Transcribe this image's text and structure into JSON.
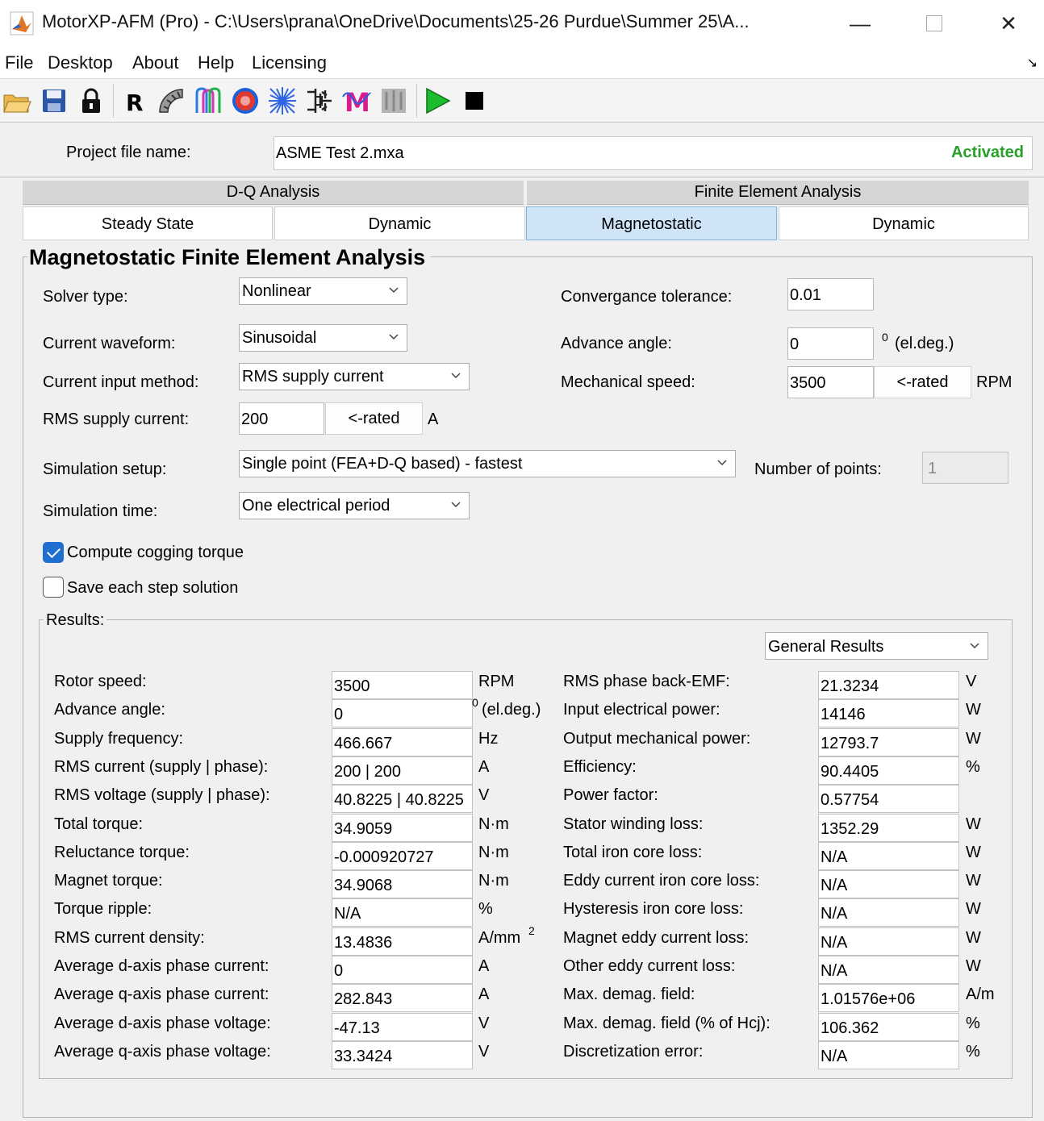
{
  "window": {
    "title": "MotorXP-AFM (Pro) - C:\\Users\\prana\\OneDrive\\Documents\\25-26 Purdue\\Summer 25\\A...",
    "minimize_glyph": "—",
    "close_glyph": "✕"
  },
  "menu": [
    "File",
    "Desktop",
    "About",
    "Help",
    "Licensing"
  ],
  "toolbar": {
    "icons": [
      "open-folder-icon",
      "save-icon",
      "lock-icon",
      "rating-r-icon",
      "stator-icon",
      "winding-icon",
      "magnet-circle-icon",
      "mesh-icon",
      "circuit-icon",
      "waveform-m-icon",
      "thermal-icon",
      "run-icon",
      "stop-icon"
    ],
    "rating_label": "R",
    "waveform_label": "M"
  },
  "project": {
    "label": "Project file name:",
    "file_name": "ASME Test 2.mxa",
    "status": "Activated",
    "status_color": "#2aa02a"
  },
  "group_tabs": [
    "D-Q Analysis",
    "Finite Element Analysis"
  ],
  "sub_tabs": [
    {
      "label": "Steady State",
      "active": false
    },
    {
      "label": "Dynamic",
      "active": false
    },
    {
      "label": "Magnetostatic",
      "active": true
    },
    {
      "label": "Dynamic",
      "active": false
    }
  ],
  "panel": {
    "title": "Magnetostatic Finite Element Analysis",
    "solver_type": {
      "label": "Solver type:",
      "value": "Nonlinear"
    },
    "current_waveform": {
      "label": "Current waveform:",
      "value": "Sinusoidal"
    },
    "current_input_method": {
      "label": "Current input method:",
      "value": "RMS supply current"
    },
    "rms_supply_current": {
      "label": "RMS supply current:",
      "value": "200",
      "button": "<-rated",
      "unit": "A"
    },
    "convergence_tolerance": {
      "label": "Convergance tolerance:",
      "value": "0.01"
    },
    "advance_angle": {
      "label": "Advance angle:",
      "value": "0",
      "unit_sup": "0",
      "unit": "(el.deg.)"
    },
    "mechanical_speed": {
      "label": "Mechanical speed:",
      "value": "3500",
      "button": "<-rated",
      "unit": "RPM"
    },
    "simulation_setup": {
      "label": "Simulation setup:",
      "value": "Single point (FEA+D-Q based) - fastest"
    },
    "number_of_points": {
      "label": "Number of points:",
      "value": "1"
    },
    "simulation_time": {
      "label": "Simulation time:",
      "value": "One electrical period"
    },
    "compute_cogging": {
      "label": "Compute cogging torque",
      "checked": true
    },
    "save_each_step": {
      "label": "Save each step solution",
      "checked": false
    }
  },
  "results": {
    "title": "Results:",
    "view": "General Results",
    "left": [
      {
        "label": "Rotor speed:",
        "value": "3500",
        "unit": "RPM"
      },
      {
        "label": "Advance angle:",
        "value": "0",
        "unit": "(el.deg.)",
        "unit_sup": "0"
      },
      {
        "label": "Supply frequency:",
        "value": "466.667",
        "unit": "Hz"
      },
      {
        "label": "RMS current (supply | phase):",
        "value": "200 | 200",
        "unit": "A"
      },
      {
        "label": "RMS voltage (supply | phase):",
        "value": "40.8225 | 40.8225",
        "unit": "V"
      },
      {
        "label": "Total torque:",
        "value": "34.9059",
        "unit": "N·m"
      },
      {
        "label": "Reluctance torque:",
        "value": "-0.000920727",
        "unit": "N·m"
      },
      {
        "label": "Magnet torque:",
        "value": "34.9068",
        "unit": "N·m"
      },
      {
        "label": "Torque ripple:",
        "value": "N/A",
        "unit": "%"
      },
      {
        "label": "RMS current density:",
        "value": "13.4836",
        "unit": "A/mm",
        "unit_sup": "2"
      },
      {
        "label": "Average d-axis phase current:",
        "value": "0",
        "unit": "A"
      },
      {
        "label": "Average q-axis phase current:",
        "value": "282.843",
        "unit": "A"
      },
      {
        "label": "Average d-axis phase voltage:",
        "value": "-47.13",
        "unit": "V"
      },
      {
        "label": "Average q-axis phase voltage:",
        "value": "33.3424",
        "unit": "V"
      }
    ],
    "right": [
      {
        "label": "RMS phase back-EMF:",
        "value": "21.3234",
        "unit": "V"
      },
      {
        "label": "Input electrical power:",
        "value": "14146",
        "unit": "W"
      },
      {
        "label": "Output mechanical power:",
        "value": "12793.7",
        "unit": "W"
      },
      {
        "label": "Efficiency:",
        "value": "90.4405",
        "unit": "%"
      },
      {
        "label": "Power factor:",
        "value": "0.57754",
        "unit": ""
      },
      {
        "label": "Stator winding loss:",
        "value": "1352.29",
        "unit": "W"
      },
      {
        "label": "Total iron core loss:",
        "value": "N/A",
        "unit": "W"
      },
      {
        "label": "Eddy current iron core loss:",
        "value": "N/A",
        "unit": "W"
      },
      {
        "label": "Hysteresis iron core loss:",
        "value": "N/A",
        "unit": "W"
      },
      {
        "label": "Magnet eddy current loss:",
        "value": "N/A",
        "unit": "W"
      },
      {
        "label": "Other eddy current loss:",
        "value": "N/A",
        "unit": "W"
      },
      {
        "label": "Max. demag. field:",
        "value": "1.01576e+06",
        "unit": "A/m"
      },
      {
        "label": "Max. demag. field (% of Hcj):",
        "value": "106.362",
        "unit": "%"
      },
      {
        "label": "Discretization error:",
        "value": "N/A",
        "unit": "%"
      }
    ]
  }
}
